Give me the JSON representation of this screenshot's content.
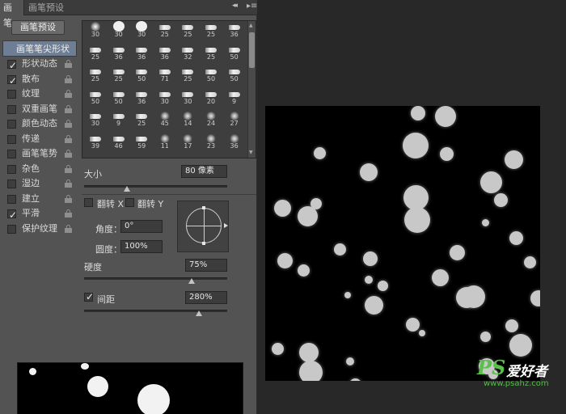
{
  "tabs": [
    {
      "label": "画笔"
    },
    {
      "label": "画笔预设"
    }
  ],
  "panel": {
    "collapse_glyph": "◂◂",
    "menu_glyph": "▸≡",
    "preset_button": "画笔预设"
  },
  "options": {
    "header": "画笔笔尖形状",
    "items": [
      {
        "label": "形状动态",
        "checked": true
      },
      {
        "label": "散布",
        "checked": true
      },
      {
        "label": "纹理",
        "checked": false
      },
      {
        "label": "双重画笔",
        "checked": false
      },
      {
        "label": "颜色动态",
        "checked": false
      },
      {
        "label": "传递",
        "checked": false
      },
      {
        "label": "画笔笔势",
        "checked": false
      },
      {
        "label": "杂色",
        "checked": false
      },
      {
        "label": "湿边",
        "checked": false
      },
      {
        "label": "建立",
        "checked": false
      },
      {
        "label": "平滑",
        "checked": true
      },
      {
        "label": "保护纹理",
        "checked": false
      }
    ]
  },
  "brush_grid": {
    "rows": [
      [
        "30",
        "30",
        "30",
        "25",
        "25",
        "25",
        "36"
      ],
      [
        "25",
        "36",
        "36",
        "36",
        "32",
        "25",
        "50"
      ],
      [
        "25",
        "25",
        "50",
        "71",
        "25",
        "50",
        "50"
      ],
      [
        "50",
        "50",
        "36",
        "30",
        "30",
        "20",
        "9"
      ],
      [
        "30",
        "9",
        "25",
        "45",
        "14",
        "24",
        "27"
      ],
      [
        "39",
        "46",
        "59",
        "11",
        "17",
        "23",
        "36"
      ]
    ]
  },
  "size": {
    "label": "大小",
    "value": "80 像素",
    "level": 0.3
  },
  "flip": {
    "x_label": "翻转 X",
    "y_label": "翻转 Y"
  },
  "angle": {
    "label": "角度：",
    "value": "0°"
  },
  "roundness": {
    "label": "圆度：",
    "value": "100%"
  },
  "hardness": {
    "label": "硬度",
    "value": "75%",
    "level": 0.75
  },
  "spacing": {
    "label": "间距",
    "value": "280%",
    "checked": true,
    "level": 0.8
  },
  "watermark": {
    "logo": "PS",
    "text": "爱好者",
    "url": "www.psahz.com"
  }
}
